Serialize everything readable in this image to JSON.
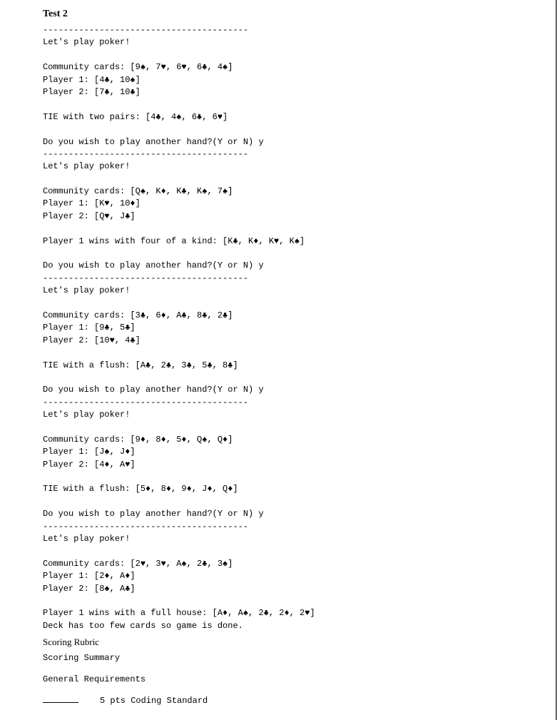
{
  "heading": "Test 2",
  "divider": "----------------------------------------",
  "lets_play": "Let's play poker!",
  "again_prompt": "Do you wish to play another hand?(Y or N) y",
  "hands": [
    {
      "community": "Community cards: [9♠, 7♥, 6♥, 6♣, 4♠]",
      "p1": "Player 1: [4♣, 10♠]",
      "p2": "Player 2: [7♣, 10♣]",
      "result": "TIE with two pairs: [4♣, 4♠, 6♣, 6♥]"
    },
    {
      "community": "Community cards: [Q♠, K♦, K♣, K♠, 7♠]",
      "p1": "Player 1: [K♥, 10♦]",
      "p2": "Player 2: [Q♥, J♣]",
      "result": "Player 1 wins with four of a kind: [K♣, K♦, K♥, K♠]"
    },
    {
      "community": "Community cards: [3♣, 6♦, A♣, 8♣, 2♣]",
      "p1": "Player 1: [9♣, 5♣]",
      "p2": "Player 2: [10♥, 4♣]",
      "result": "TIE with a flush: [A♣, 2♣, 3♣, 5♣, 8♣]"
    },
    {
      "community": "Community cards: [9♦, 8♦, 5♦, Q♠, Q♦]",
      "p1": "Player 1: [J♠, J♦]",
      "p2": "Player 2: [4♦, A♥]",
      "result": "TIE with a flush: [5♦, 8♦, 9♦, J♦, Q♦]"
    },
    {
      "community": "Community cards: [2♥, 3♥, A♠, 2♣, 3♠]",
      "p1": "Player 1: [2♦, A♦]",
      "p2": "Player 2: [8♠, A♣]",
      "result": "Player 1 wins with a full house: [A♦, A♠, 2♣, 2♦, 2♥]"
    }
  ],
  "deck_done": "Deck has too few cards so game is done.",
  "rubric_heading": "Scoring Rubric",
  "scoring_summary": "Scoring Summary",
  "general_req": "General Requirements",
  "score_item": "5 pts Coding Standard"
}
